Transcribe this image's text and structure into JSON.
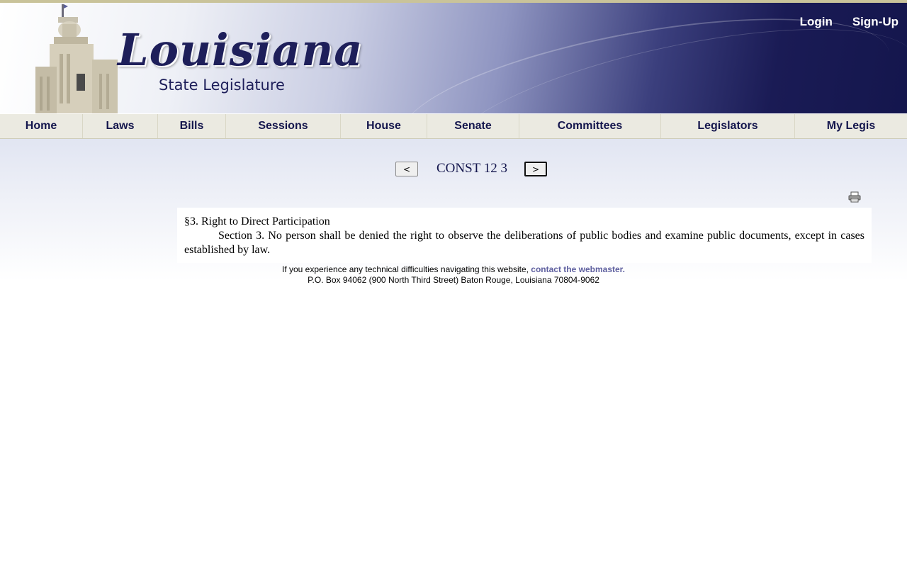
{
  "header": {
    "logo_word": "Louisiana",
    "logo_sub": "State Legislature",
    "login_label": "Login",
    "signup_label": "Sign-Up"
  },
  "nav": {
    "items": [
      {
        "label": "Home"
      },
      {
        "label": "Laws"
      },
      {
        "label": "Bills"
      },
      {
        "label": "Sessions"
      },
      {
        "label": "House"
      },
      {
        "label": "Senate"
      },
      {
        "label": "Committees"
      },
      {
        "label": "Legislators"
      },
      {
        "label": "My Legis"
      }
    ]
  },
  "pager": {
    "prev_label": "<",
    "next_label": ">",
    "title": "CONST 12 3"
  },
  "document": {
    "heading": "§3.  Right to Direct Participation",
    "body": "Section 3.  No person shall be denied the right to observe the deliberations of public bodies and examine public documents, except in cases established by law."
  },
  "footer": {
    "line1_text": "If you experience any technical difficulties navigating this website, ",
    "link_text": "contact the webmaster.",
    "line2_text": "P.O. Box 94062 (900 North Third Street) Baton Rouge, Louisiana 70804-9062"
  },
  "icons": {
    "print": "print-icon"
  }
}
